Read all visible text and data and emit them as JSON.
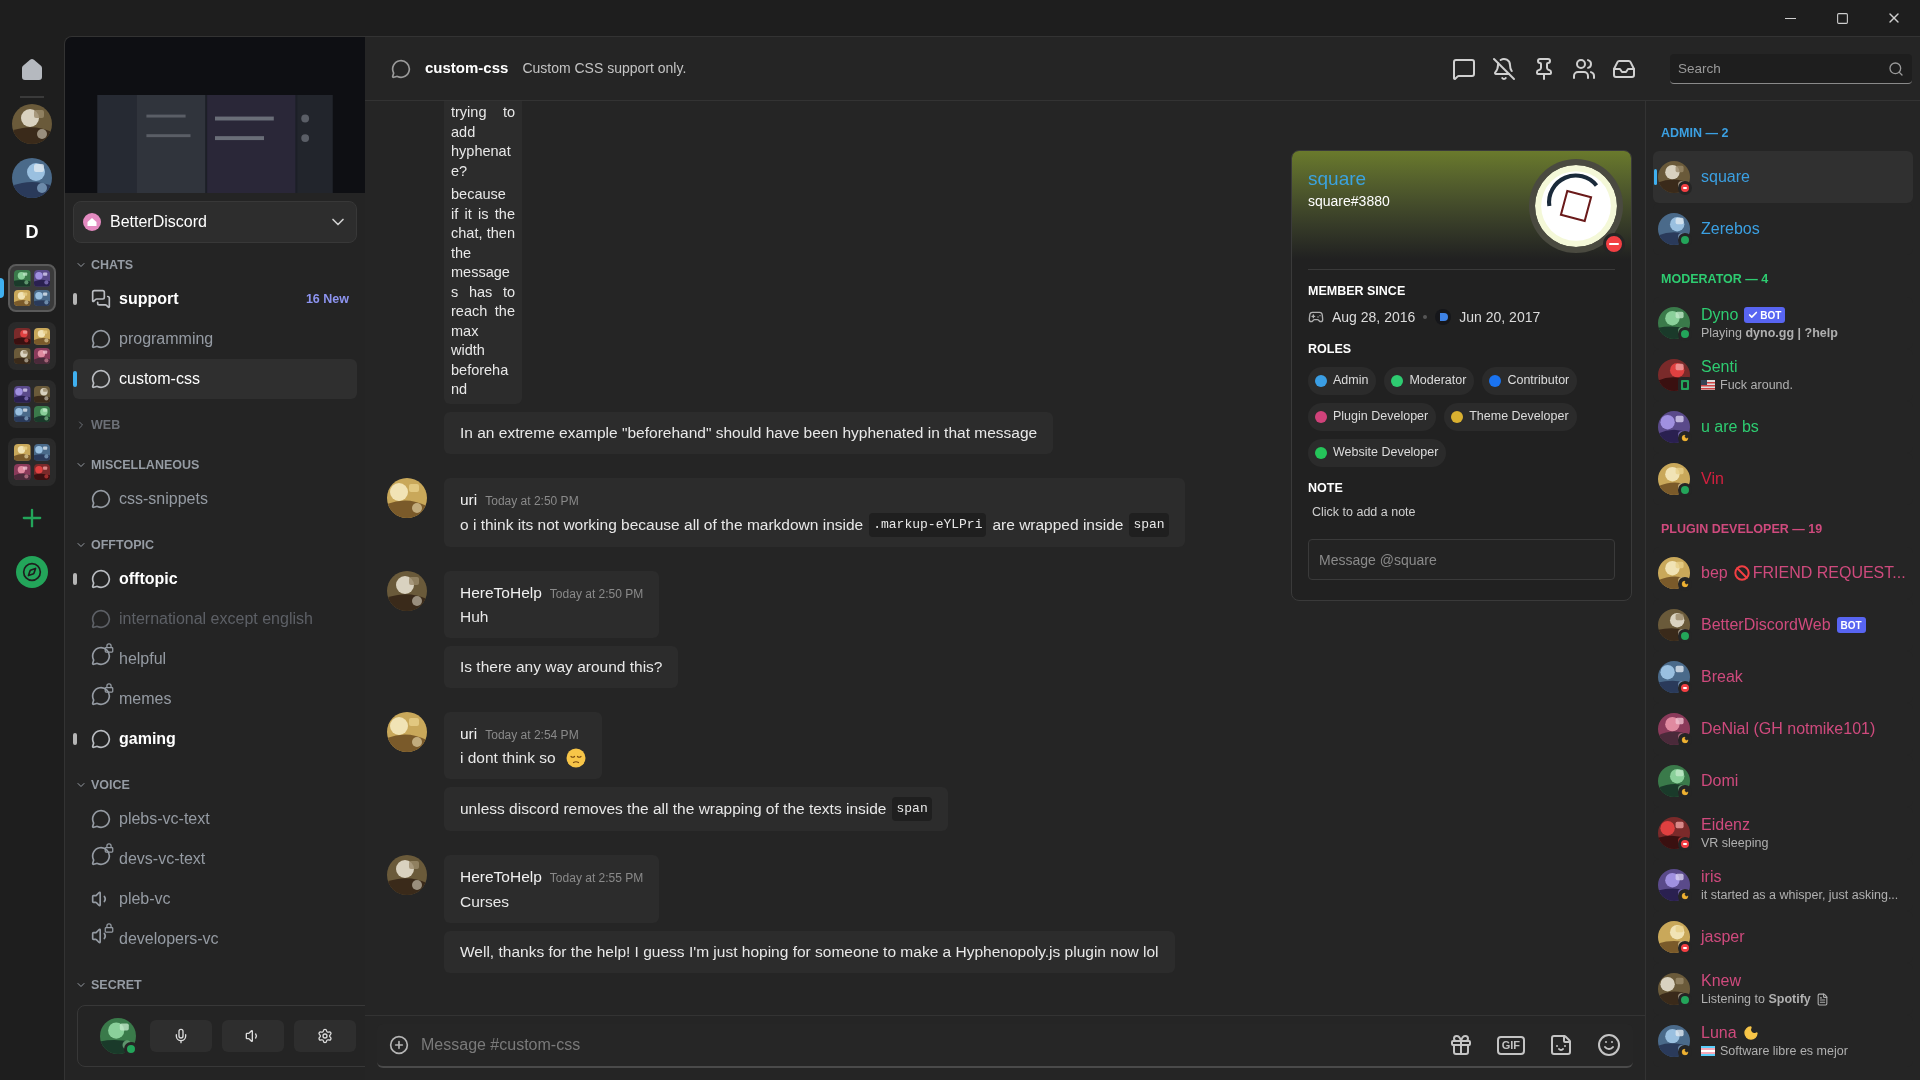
{
  "server_rail": {
    "items": [
      {
        "kind": "home",
        "selected": false
      },
      {
        "kind": "avatar",
        "selected": false
      },
      {
        "kind": "avatar",
        "selected": false
      },
      {
        "kind": "letter",
        "label": "D",
        "selected": false
      },
      {
        "kind": "folder",
        "selected": true
      },
      {
        "kind": "folder",
        "selected": false
      },
      {
        "kind": "folder",
        "selected": false
      },
      {
        "kind": "folder",
        "selected": false
      },
      {
        "kind": "add",
        "selected": false
      },
      {
        "kind": "explore",
        "selected": false
      }
    ]
  },
  "sidebar": {
    "server_name": "BetterDiscord",
    "categories": [
      {
        "name": "CHATS",
        "expanded": true,
        "channels": [
          {
            "name": "support",
            "kind": "forum",
            "unread": true,
            "muted": false,
            "selected": false,
            "badge": "16 New"
          },
          {
            "name": "programming",
            "kind": "text",
            "unread": false,
            "muted": false,
            "selected": false
          },
          {
            "name": "custom-css",
            "kind": "text",
            "unread": false,
            "muted": false,
            "selected": true
          }
        ]
      },
      {
        "name": "WEB",
        "expanded": false
      },
      {
        "name": "MISCELLANEOUS",
        "expanded": true,
        "channels": [
          {
            "name": "css-snippets",
            "kind": "text",
            "unread": false,
            "muted": false,
            "selected": false
          }
        ]
      },
      {
        "name": "OFFTOPIC",
        "expanded": true,
        "channels": [
          {
            "name": "offtopic",
            "kind": "text",
            "unread": true,
            "muted": false,
            "selected": false
          },
          {
            "name": "international except english",
            "kind": "text",
            "unread": false,
            "muted": true,
            "selected": false
          },
          {
            "name": "helpful",
            "kind": "locked",
            "unread": false,
            "muted": false,
            "selected": false
          },
          {
            "name": "memes",
            "kind": "locked",
            "unread": false,
            "muted": false,
            "selected": false
          },
          {
            "name": "gaming",
            "kind": "text",
            "unread": true,
            "muted": false,
            "selected": false
          }
        ]
      },
      {
        "name": "VOICE",
        "expanded": true,
        "channels": [
          {
            "name": "plebs-vc-text",
            "kind": "text",
            "unread": false,
            "muted": false,
            "selected": false
          },
          {
            "name": "devs-vc-text",
            "kind": "locked",
            "unread": false,
            "muted": false,
            "selected": false
          },
          {
            "name": "pleb-vc",
            "kind": "voice",
            "unread": false,
            "muted": false,
            "selected": false
          },
          {
            "name": "developers-vc",
            "kind": "lockedvoice",
            "unread": false,
            "muted": false,
            "selected": false
          }
        ]
      },
      {
        "name": "SECRET",
        "expanded": true
      }
    ]
  },
  "user_panel": {
    "status": {
      "kind": "online"
    }
  },
  "channel_header": {
    "name": "custom-css",
    "topic": "Custom CSS support only."
  },
  "search": {
    "placeholder": "Search"
  },
  "messages": [
    {
      "bubbles": [
        {
          "kind": "narrow",
          "parts": [
            {
              "kind": "paragraph",
              "text": "trying to add hyphenate?"
            },
            {
              "kind": "paragraph",
              "text": "because if it is the chat, then the messages has to reach the max width beforehand"
            }
          ]
        },
        {
          "kind": "normal",
          "parts": [
            {
              "kind": "text",
              "text": "In an extreme example \"beforehand\" should have been hyphenated in that message"
            }
          ]
        }
      ]
    },
    {
      "author": "uri",
      "time": "Today at 2:50 PM",
      "bubbles": [
        {
          "kind": "normal",
          "parts": [
            {
              "kind": "text",
              "text": "o i think its not working because all of the markdown inside"
            },
            {
              "kind": "code",
              "text": ".markup-eYLPri"
            },
            {
              "kind": "text",
              "text": "are wrapped inside"
            },
            {
              "kind": "code",
              "text": "span"
            }
          ]
        }
      ]
    },
    {
      "author": "HereToHelp",
      "time": "Today at 2:50 PM",
      "bubbles": [
        {
          "kind": "normal",
          "parts": [
            {
              "kind": "text",
              "text": "Huh"
            }
          ]
        },
        {
          "kind": "normal",
          "parts": [
            {
              "kind": "text",
              "text": "Is there any way around this?"
            }
          ]
        }
      ]
    },
    {
      "author": "uri",
      "time": "Today at 2:54 PM",
      "bubbles": [
        {
          "kind": "normal",
          "parts": [
            {
              "kind": "text",
              "text": "i dont think so"
            },
            {
              "kind": "emoji"
            }
          ]
        },
        {
          "kind": "normal",
          "parts": [
            {
              "kind": "text",
              "text": "unless discord removes the all the wrapping of the texts inside"
            },
            {
              "kind": "code",
              "text": "span"
            }
          ]
        }
      ]
    },
    {
      "author": "HereToHelp",
      "time": "Today at 2:55 PM",
      "bubbles": [
        {
          "kind": "normal",
          "parts": [
            {
              "kind": "text",
              "text": "Curses"
            }
          ]
        },
        {
          "kind": "normal",
          "parts": [
            {
              "kind": "text",
              "text": "Well, thanks for the help! I guess I'm just hoping for someone to make a Hyphenopoly.js plugin now lol"
            }
          ]
        }
      ]
    }
  ],
  "composer": {
    "placeholder": "Message #custom-css",
    "gif_label": "GIF"
  },
  "profile_popup": {
    "name": "square",
    "tag": "square#3880",
    "status": {
      "kind": "dnd"
    },
    "member_since_title": "MEMBER SINCE",
    "discord_since": "Aug 28, 2016",
    "server_since": "Jun 20, 2017",
    "roles_title": "ROLES",
    "roles": [
      {
        "name": "Admin",
        "color": "#3a9ee4"
      },
      {
        "name": "Moderator",
        "color": "#2ecc71"
      },
      {
        "name": "Contributor",
        "color": "#1a73f0"
      },
      {
        "name": "Plugin Developer",
        "color": "#d0427a"
      },
      {
        "name": "Theme Developer",
        "color": "#d9b030"
      },
      {
        "name": "Website Developer",
        "color": "#25c55a"
      }
    ],
    "note_title": "NOTE",
    "note_placeholder": "Click to add a note",
    "message_placeholder": "Message @square"
  },
  "member_list": {
    "groups": [
      {
        "title": "ADMIN — 2",
        "color": "#3ba0e2",
        "members": [
          {
            "name": "square",
            "status": {
              "kind": "dnd"
            },
            "selected": true
          },
          {
            "name": "Zerebos",
            "status": {
              "kind": "online"
            },
            "selected": false
          }
        ]
      },
      {
        "title": "MODERATOR — 4",
        "color": "#2ecc71",
        "members": [
          {
            "name": "Dyno",
            "status": {
              "kind": "online"
            },
            "selected": false,
            "bot": {
              "label": "BOT",
              "verified": true
            },
            "activity": {
              "kind": "plain",
              "text": "Playing **dyno.gg | ?help**"
            }
          },
          {
            "name": "Senti",
            "status": {
              "kind": "mobile"
            },
            "selected": false,
            "activity": {
              "kind": "usflag",
              "text": "Fuck around."
            }
          },
          {
            "name": "u are bs",
            "status": {
              "kind": "idle"
            },
            "selected": false
          },
          {
            "name": "Vin",
            "status": {
              "kind": "online"
            },
            "selected": false,
            "color": "#d3203f"
          }
        ]
      },
      {
        "title": "PLUGIN DEVELOPER — 19",
        "color": "#cf4a7d",
        "members": [
          {
            "name": "bep",
            "status": {
              "kind": "idle"
            },
            "selected": false,
            "name_icon": {
              "kind": "prohibited"
            },
            "name_suffix": "FRIEND REQUEST..."
          },
          {
            "name": "BetterDiscordWeb",
            "status": {
              "kind": "online"
            },
            "selected": false,
            "bot": {
              "label": "BOT",
              "verified": false
            }
          },
          {
            "name": "Break",
            "status": {
              "kind": "dnd"
            },
            "selected": false
          },
          {
            "name": "DeNial (GH notmike101)",
            "status": {
              "kind": "idle"
            },
            "selected": false
          },
          {
            "name": "Domi",
            "status": {
              "kind": "idle"
            },
            "selected": false
          },
          {
            "name": "Eidenz",
            "status": {
              "kind": "dnd"
            },
            "selected": false,
            "activity": {
              "kind": "plain",
              "text": "VR sleeping"
            }
          },
          {
            "name": "iris",
            "status": {
              "kind": "idle"
            },
            "selected": false,
            "activity": {
              "kind": "plain",
              "text": "it started as a whisper, just asking..."
            }
          },
          {
            "name": "jasper",
            "status": {
              "kind": "dnd"
            },
            "selected": false
          },
          {
            "name": "Knew",
            "status": {
              "kind": "online"
            },
            "selected": false,
            "activity": {
              "kind": "document",
              "text": "Listening to **Spotify**"
            }
          },
          {
            "name": "Luna",
            "status": {
              "kind": "idle"
            },
            "selected": false,
            "name_icon": {
              "kind": "moon"
            },
            "activity": {
              "kind": "transflag",
              "text": "Software libre es mejor"
            }
          }
        ]
      }
    ]
  }
}
